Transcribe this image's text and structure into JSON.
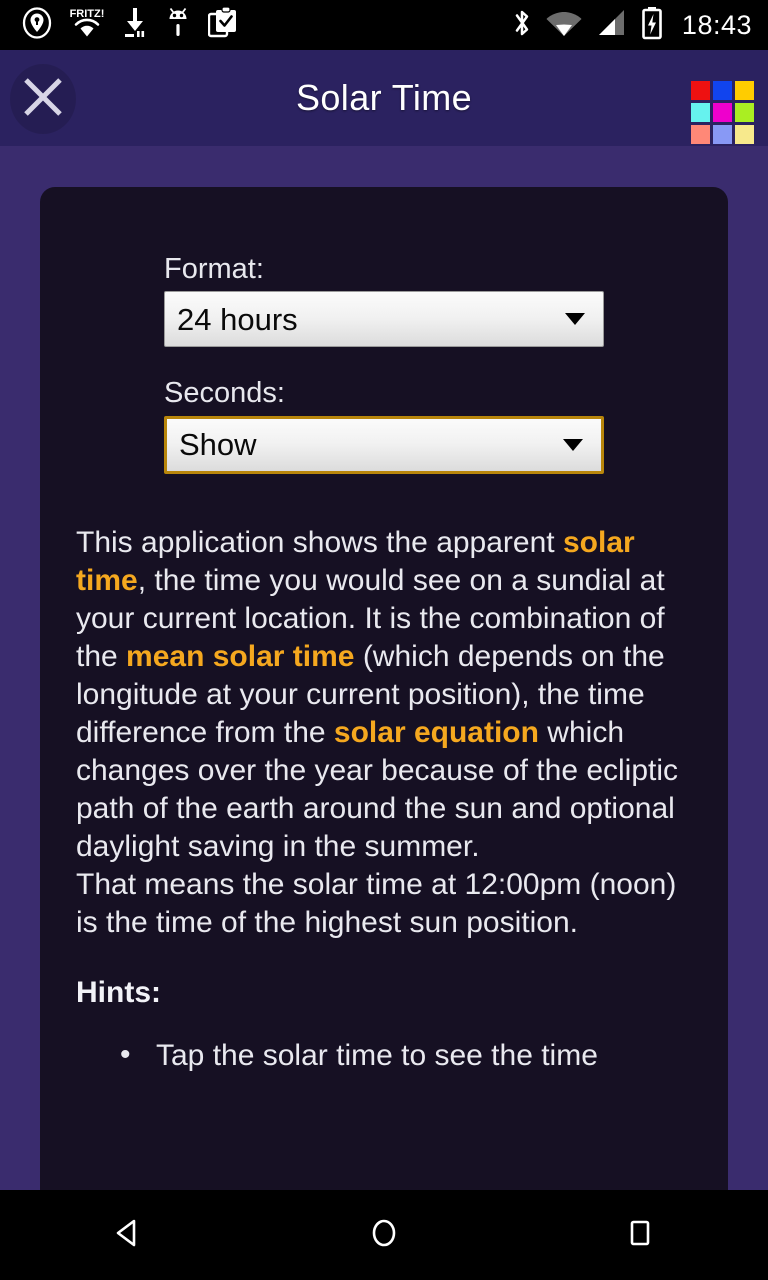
{
  "statusbar": {
    "time": "18:43",
    "left_icons": [
      {
        "name": "location-icon",
        "label": "location"
      },
      {
        "name": "wifi-fritz-icon",
        "label": "FRITZ!"
      },
      {
        "name": "download-icon",
        "label": "download paused"
      },
      {
        "name": "android-bug-icon",
        "label": "android"
      },
      {
        "name": "clipboard-check-icon",
        "label": "clipboard"
      }
    ],
    "right_icons": [
      {
        "name": "bluetooth-icon",
        "label": "bluetooth"
      },
      {
        "name": "wifi-icon",
        "label": "wifi"
      },
      {
        "name": "cell-signal-icon",
        "label": "signal"
      },
      {
        "name": "battery-charging-icon",
        "label": "battery charging"
      }
    ]
  },
  "appbar": {
    "title": "Solar Time",
    "close_icon": "close-icon",
    "grid_icon": "color-grid-icon",
    "background": "#2b2260",
    "grid_colors": [
      "#ee1111",
      "#1144ee",
      "#ffcc00",
      "#66f2ee",
      "#ee00cc",
      "#aaee22",
      "#ff8877",
      "#8899f5",
      "#f7e98c"
    ]
  },
  "settings": {
    "format_label": "Format:",
    "format_value": "24 hours",
    "seconds_label": "Seconds:",
    "seconds_value": "Show",
    "focus_color": "#b8860b",
    "caret_icon": "chevron-down-icon"
  },
  "description": {
    "p1_a": "This application shows the apparent ",
    "p1_hl1": "solar time",
    "p1_b": ", the time you would see on a sundial at your current location. It is the combination of the ",
    "p1_hl2": "mean solar time",
    "p1_c": " (which depends on the longitude at your current position), the time difference from the ",
    "p1_hl3": "solar equation",
    "p1_d": " which changes over the year because of the ecliptic path of the earth around the sun and optional daylight saving in the summer.",
    "p2": "That means the solar time at 12:00pm (noon) is the time of the highest sun position.",
    "hints_title": "Hints:",
    "hints": [
      "Tap the solar time to see the time"
    ],
    "highlight_color": "#f5a81f"
  },
  "navbar": {
    "back": "back-icon",
    "home": "home-icon",
    "recents": "recents-icon"
  }
}
